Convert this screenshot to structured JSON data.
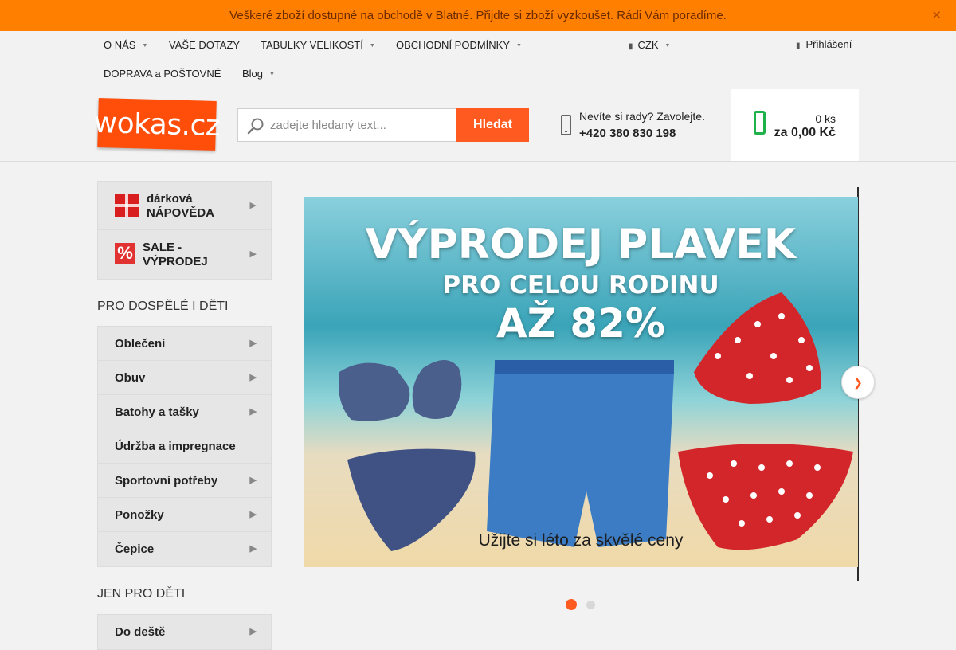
{
  "notice": {
    "text": "Veškeré zboží dostupné na obchodě v Blatné. Přijdte si zboží vyzkoušet. Rádi Vám poradíme.",
    "close_icon": "close-icon"
  },
  "topnav": {
    "items": [
      {
        "label": "O NÁS",
        "has_dropdown": true
      },
      {
        "label": "VAŠE DOTAZY",
        "has_dropdown": false
      },
      {
        "label": "TABULKY VELIKOSTÍ",
        "has_dropdown": true
      },
      {
        "label": "OBCHODNÍ PODMÍNKY",
        "has_dropdown": true
      },
      {
        "label": "DOPRAVA a POŠTOVNÉ",
        "has_dropdown": false
      },
      {
        "label": "Blog",
        "has_dropdown": true
      }
    ],
    "currency": "CZK",
    "login": "Přihlášení"
  },
  "header": {
    "logo_text": "wokas.cz",
    "search_placeholder": "zadejte hledaný text...",
    "search_button": "Hledat",
    "help_text": "Nevíte si rady? Zavolejte.",
    "phone": "+420 380 830 198",
    "cart_count": "0 ks",
    "cart_total": "za 0,00 Kč"
  },
  "sidebar": {
    "promo": [
      {
        "label_line1": "dárková",
        "label_line2": "NÁPOVĚDA",
        "icon": "gift-icon"
      },
      {
        "label_line1": "SALE -",
        "label_line2": "VÝPRODEJ",
        "icon": "percent-icon"
      }
    ],
    "section1_title": "PRO DOSPĚLÉ I DĚTI",
    "section1_items": [
      {
        "label": "Oblečení",
        "has_sub": true
      },
      {
        "label": "Obuv",
        "has_sub": true
      },
      {
        "label": "Batohy a tašky",
        "has_sub": true
      },
      {
        "label": "Údržba a impregnace",
        "has_sub": false
      },
      {
        "label": "Sportovní potřeby",
        "has_sub": true
      },
      {
        "label": "Ponožky",
        "has_sub": true
      },
      {
        "label": "Čepice",
        "has_sub": true
      }
    ],
    "section2_title": "JEN PRO DĚTI",
    "section2_items": [
      {
        "label": "Do deště",
        "has_sub": true
      }
    ]
  },
  "banner": {
    "title": "VÝPRODEJ PLAVEK",
    "subtitle": "PRO CELOU RODINU",
    "discount": "AŽ 82%",
    "tagline": "Užijte si léto za skvělé ceny",
    "slides_count": 2,
    "active_slide": 1
  },
  "colors": {
    "accent": "#ff5a1f",
    "notice_bg": "#ff7f00",
    "cart_icon": "#1fb14a"
  }
}
